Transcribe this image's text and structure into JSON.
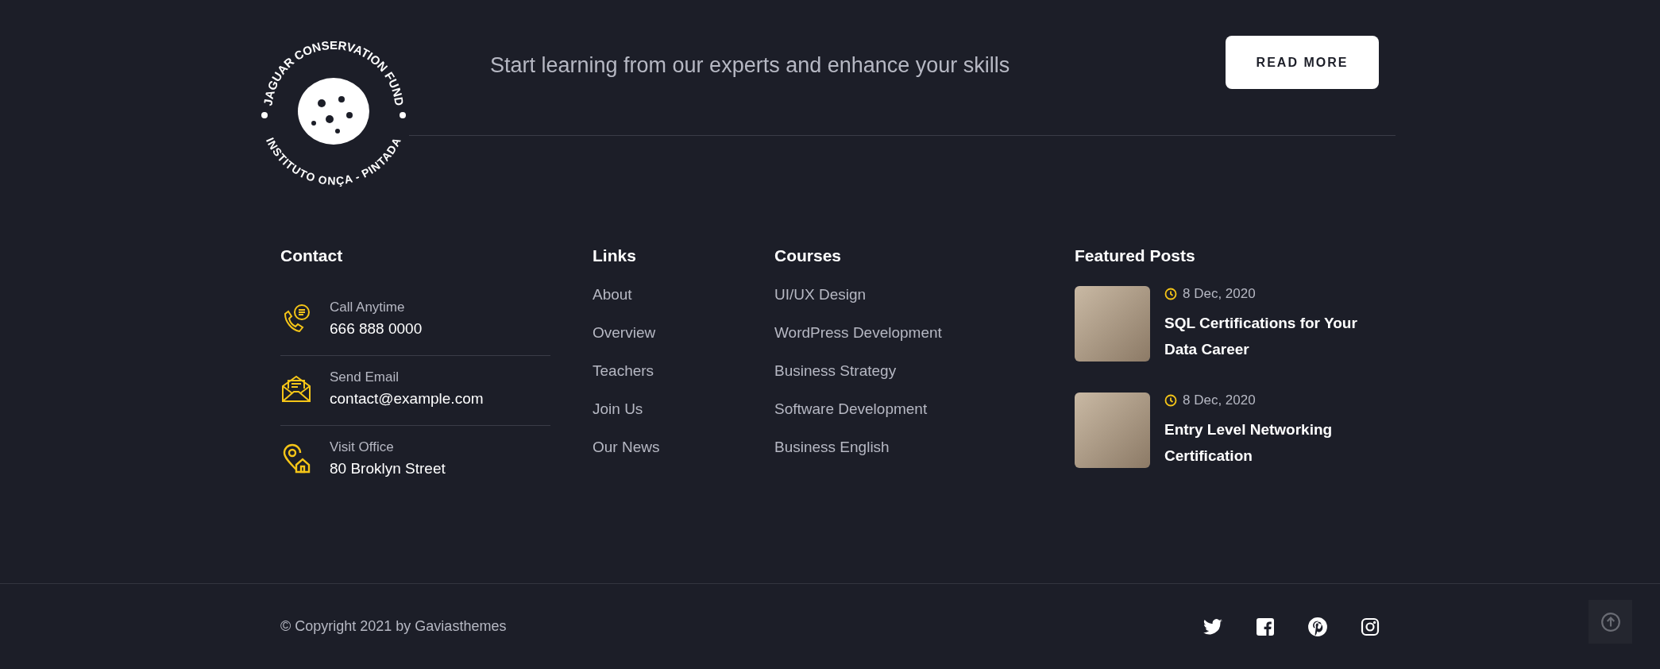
{
  "logo": {
    "top_text": "JAGUAR CONSERVATION FUND",
    "bottom_text": "INSTITUTO ONÇA - PINTADA"
  },
  "tagline": "Start learning from our experts and enhance your skills",
  "cta_button": "READ MORE",
  "contact": {
    "title": "Contact",
    "items": [
      {
        "kind": "phone",
        "label": "Call Anytime",
        "value": "666 888 0000"
      },
      {
        "kind": "email",
        "label": "Send Email",
        "value": "contact@example.com"
      },
      {
        "kind": "office",
        "label": "Visit Office",
        "value": "80 Broklyn Street"
      }
    ]
  },
  "links": {
    "title": "Links",
    "items": [
      "About",
      "Overview",
      "Teachers",
      "Join Us",
      "Our News"
    ]
  },
  "courses": {
    "title": "Courses",
    "items": [
      "UI/UX Design",
      "WordPress Development",
      "Business Strategy",
      "Software Development",
      "Business English"
    ]
  },
  "featured_posts": {
    "title": "Featured Posts",
    "items": [
      {
        "date": "8 Dec, 2020",
        "title": "SQL Certifications for Your Data Career"
      },
      {
        "date": "8 Dec, 2020",
        "title": "Entry Level Networking Certification"
      }
    ]
  },
  "copyright": "© Copyright 2021 by Gaviasthemes",
  "social": [
    {
      "kind": "twitter"
    },
    {
      "kind": "facebook"
    },
    {
      "kind": "pinterest"
    },
    {
      "kind": "instagram"
    }
  ]
}
